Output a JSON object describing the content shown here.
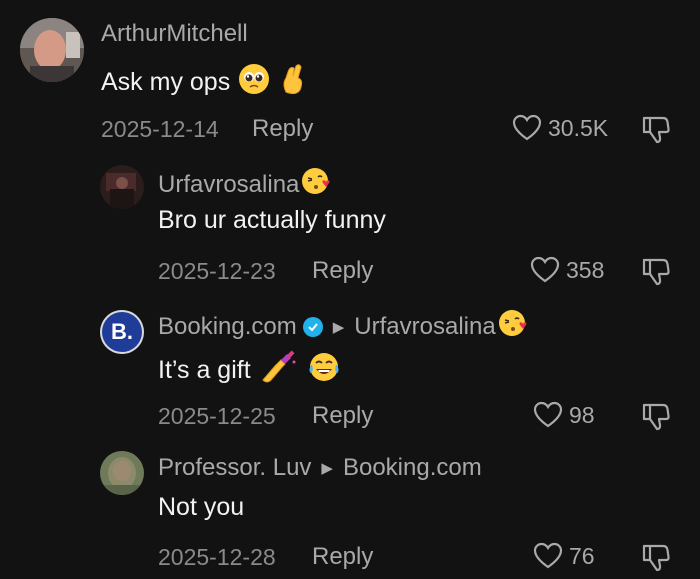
{
  "comments": [
    {
      "username": "ArthurMitchell",
      "text": "Ask my ops",
      "date": "2025-12-14",
      "reply_label": "Reply",
      "likes": "30.5K",
      "emojis": [
        "pleading-face",
        "crossed-fingers"
      ]
    },
    {
      "username": "Urfavrosalina",
      "text": "Bro ur actually funny",
      "date": "2025-12-23",
      "reply_label": "Reply",
      "likes": "358",
      "emojis": [
        "kissing-heart-face"
      ]
    },
    {
      "username": "Booking.com",
      "verified": true,
      "reply_to": "Urfavrosalina",
      "avatar_letter": "B.",
      "text": "It’s a gift",
      "date": "2025-12-25",
      "reply_label": "Reply",
      "likes": "98",
      "emojis": [
        "nail-polish",
        "tears-of-joy-face"
      ]
    },
    {
      "username": "Professor. Luv",
      "reply_to": "Booking.com",
      "text": "Not you",
      "date": "2025-12-28",
      "reply_label": "Reply",
      "likes": "76",
      "emojis": []
    }
  ],
  "colors": {
    "background": "#121212",
    "username": "#a9a9a9",
    "body_text": "#f2f2f2",
    "meta": "#8a8a8a",
    "booking_brand": "#1f3c99",
    "verified": "#20b2e8"
  }
}
